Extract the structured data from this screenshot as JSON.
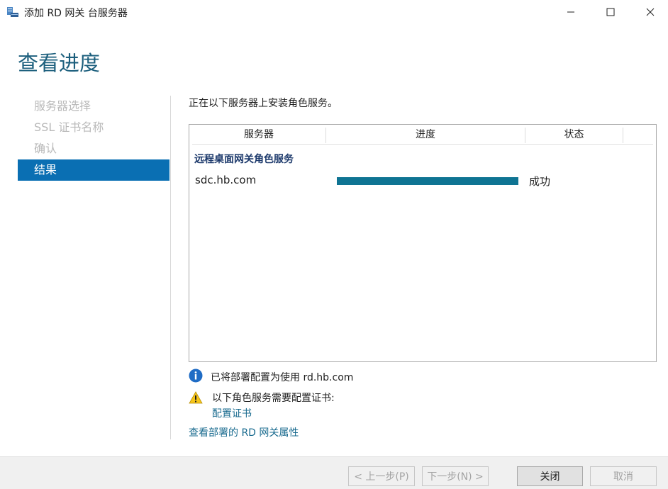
{
  "window": {
    "title": "添加 RD 网关 台服务器",
    "controls": [
      "minimize-icon",
      "maximize-icon",
      "close-icon"
    ]
  },
  "page_title": "查看进度",
  "nav": {
    "items": [
      {
        "label": "服务器选择",
        "active": false
      },
      {
        "label": "SSL 证书名称",
        "active": false
      },
      {
        "label": "确认",
        "active": false
      },
      {
        "label": "结果",
        "active": true
      }
    ]
  },
  "main": {
    "intro": "正在以下服务器上安装角色服务。",
    "table": {
      "columns": [
        "服务器",
        "进度",
        "状态"
      ],
      "group_label": "远程桌面网关角色服务",
      "rows": [
        {
          "server": "sdc.hb.com",
          "progress_fraction": 1.0,
          "status": "成功"
        }
      ]
    },
    "info_message": "已将部署配置为使用 rd.hb.com",
    "warning_message": "以下角色服务需要配置证书:",
    "warning_link": "配置证书",
    "properties_link": "查看部署的 RD 网关属性"
  },
  "footer": {
    "prev_label": "< 上一步(P)",
    "next_label": "下一步(N) >",
    "close_label": "关闭",
    "cancel_label": "取消"
  },
  "colors": {
    "accent": "#0a6fb3",
    "title": "#1c5f7d",
    "progress": "#0f7493",
    "link": "#1a6b8f",
    "group_label": "#1d3a6c"
  }
}
